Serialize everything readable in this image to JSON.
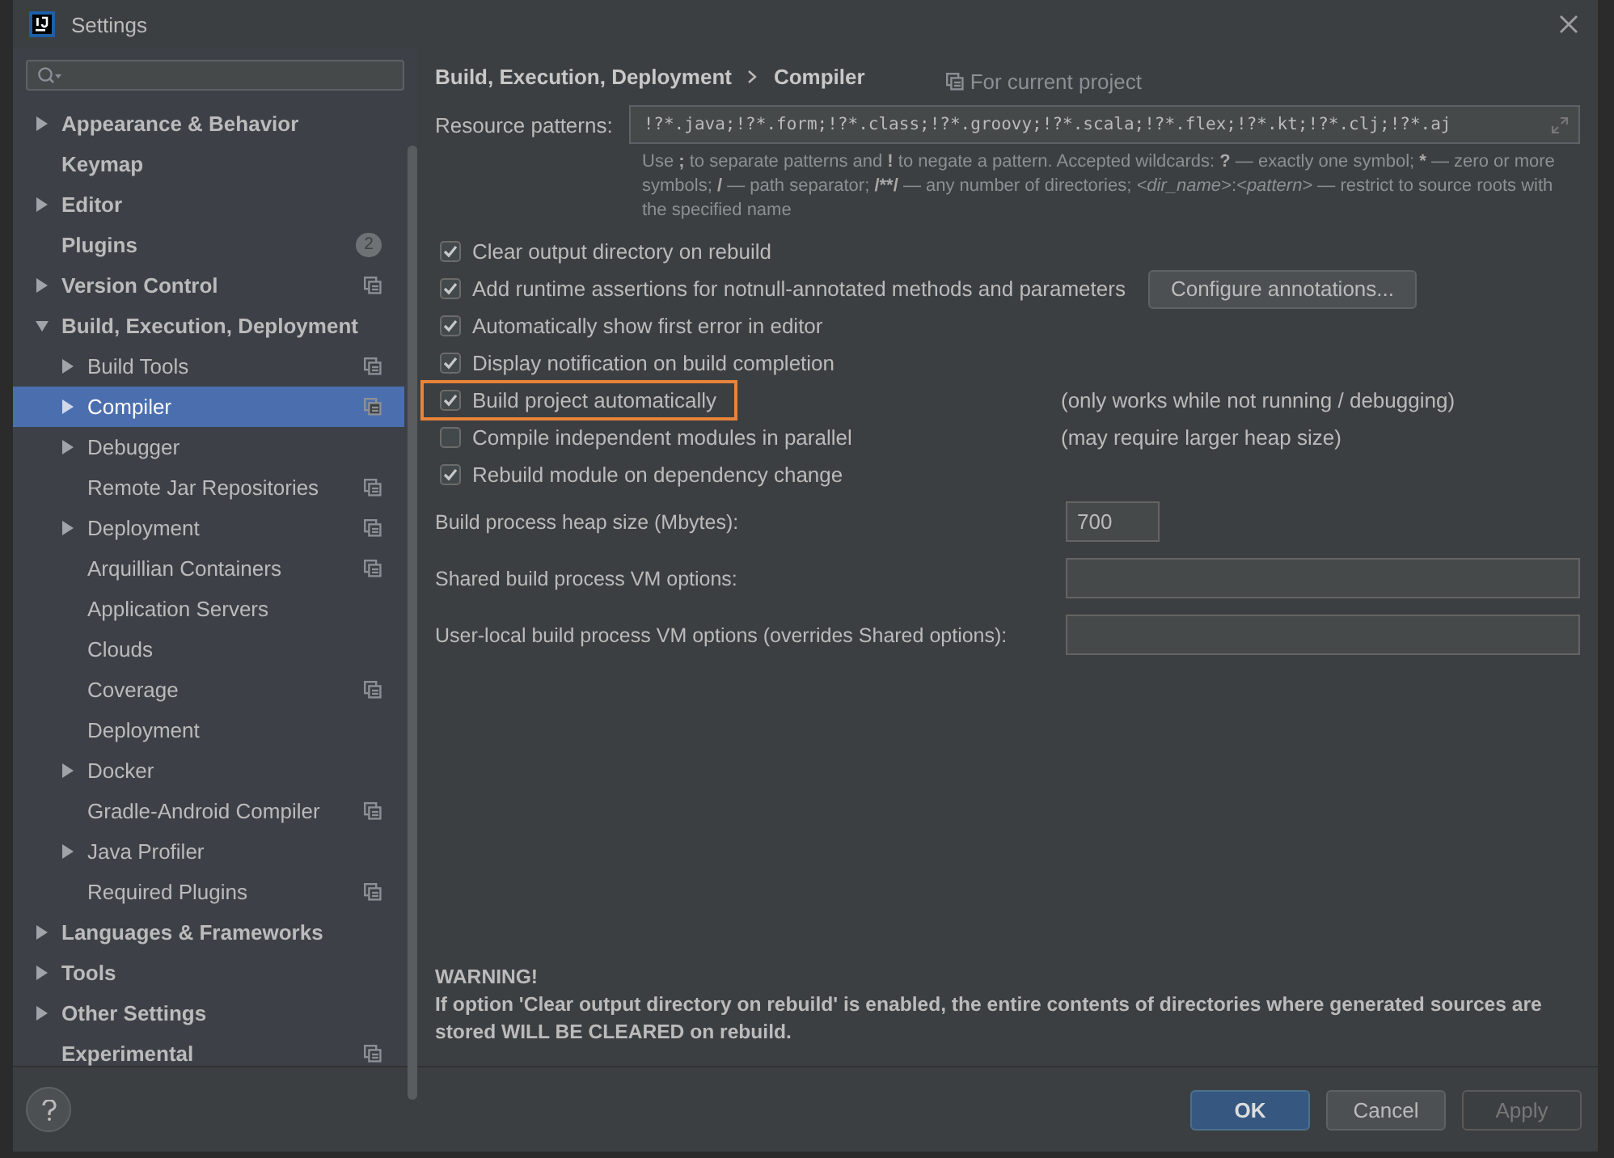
{
  "window": {
    "title": "Settings"
  },
  "sidebar": {
    "items": [
      {
        "label": "Appearance & Behavior",
        "expandable": true,
        "expanded": false,
        "selected": false
      },
      {
        "label": "Keymap",
        "expandable": false,
        "selected": false
      },
      {
        "label": "Editor",
        "expandable": true,
        "expanded": false,
        "selected": false
      },
      {
        "label": "Plugins",
        "expandable": false,
        "selected": false,
        "badge": "2"
      },
      {
        "label": "Version Control",
        "expandable": true,
        "expanded": false,
        "selected": false,
        "project_scope": true
      },
      {
        "label": "Build, Execution, Deployment",
        "expandable": true,
        "expanded": true,
        "selected": false,
        "children": [
          {
            "label": "Build Tools",
            "expandable": true,
            "expanded": false,
            "selected": false,
            "project_scope": true
          },
          {
            "label": "Compiler",
            "expandable": true,
            "expanded": false,
            "selected": true,
            "project_scope": true
          },
          {
            "label": "Debugger",
            "expandable": true,
            "expanded": false,
            "selected": false
          },
          {
            "label": "Remote Jar Repositories",
            "expandable": false,
            "selected": false,
            "project_scope": true
          },
          {
            "label": "Deployment",
            "expandable": true,
            "expanded": false,
            "selected": false,
            "project_scope": true
          },
          {
            "label": "Arquillian Containers",
            "expandable": false,
            "selected": false,
            "project_scope": true
          },
          {
            "label": "Application Servers",
            "expandable": false,
            "selected": false
          },
          {
            "label": "Clouds",
            "expandable": false,
            "selected": false
          },
          {
            "label": "Coverage",
            "expandable": false,
            "selected": false,
            "project_scope": true
          },
          {
            "label": "Deployment",
            "expandable": false,
            "selected": false
          },
          {
            "label": "Docker",
            "expandable": true,
            "expanded": false,
            "selected": false
          },
          {
            "label": "Gradle-Android Compiler",
            "expandable": false,
            "selected": false,
            "project_scope": true
          },
          {
            "label": "Java Profiler",
            "expandable": true,
            "expanded": false,
            "selected": false
          },
          {
            "label": "Required Plugins",
            "expandable": false,
            "selected": false,
            "project_scope": true
          }
        ]
      },
      {
        "label": "Languages & Frameworks",
        "expandable": true,
        "expanded": false,
        "selected": false
      },
      {
        "label": "Tools",
        "expandable": true,
        "expanded": false,
        "selected": false
      },
      {
        "label": "Other Settings",
        "expandable": true,
        "expanded": false,
        "selected": false
      },
      {
        "label": "Experimental",
        "expandable": false,
        "selected": false,
        "project_scope": true
      }
    ]
  },
  "breadcrumb": [
    "Build, Execution, Deployment",
    "Compiler"
  ],
  "scope_label": "For current project",
  "resource_patterns": {
    "label": "Resource patterns:",
    "value": "!?*.java;!?*.form;!?*.class;!?*.groovy;!?*.scala;!?*.flex;!?*.kt;!?*.clj;!?*.aj",
    "hint": [
      {
        "text": "Use "
      },
      {
        "text": ";",
        "kind": "symbol"
      },
      {
        "text": " to separate patterns and "
      },
      {
        "text": "!",
        "kind": "symbol"
      },
      {
        "text": " to negate a pattern. Accepted wildcards: "
      },
      {
        "text": "?",
        "kind": "symbol"
      },
      {
        "text": " — exactly one symbol; "
      },
      {
        "text": "*",
        "kind": "symbol"
      },
      {
        "text": " — zero or more symbols; "
      },
      {
        "text": "/",
        "kind": "symbol"
      },
      {
        "text": " — path separator; "
      },
      {
        "text": "/**/",
        "kind": "symbol"
      },
      {
        "text": " — any number of directories; "
      },
      {
        "text": "<dir_name>",
        "kind": "placeholder"
      },
      {
        "text": ":"
      },
      {
        "text": "<pattern>",
        "kind": "placeholder"
      },
      {
        "text": " — restrict to source roots with the specified name"
      }
    ]
  },
  "options": [
    {
      "label": "Clear output directory on rebuild",
      "checked": true,
      "highlighted": false
    },
    {
      "label": "Add runtime assertions for notnull-annotated methods and parameters",
      "checked": true,
      "highlighted": false,
      "button": "Configure annotations..."
    },
    {
      "label": "Automatically show first error in editor",
      "checked": true,
      "highlighted": false
    },
    {
      "label": "Display notification on build completion",
      "checked": true,
      "highlighted": false
    },
    {
      "label": "Build project automatically",
      "checked": true,
      "highlighted": true,
      "note": "(only works while not running / debugging)"
    },
    {
      "label": "Compile independent modules in parallel",
      "checked": false,
      "highlighted": false,
      "note": "(may require larger heap size)"
    },
    {
      "label": "Rebuild module on dependency change",
      "checked": true,
      "highlighted": false
    }
  ],
  "fields": [
    {
      "label": "Build process heap size (Mbytes):",
      "value": "700",
      "kind": "short"
    },
    {
      "label": "Shared build process VM options:",
      "kind": "wide"
    },
    {
      "label": "User-local build process VM options (overrides Shared options):",
      "kind": "wide"
    }
  ],
  "warning": {
    "title": "WARNING!",
    "text": "If option 'Clear output directory on rebuild' is enabled, the entire contents of directories where generated sources are stored WILL BE CLEARED on rebuild."
  },
  "buttons": [
    {
      "label": "OK",
      "kind": "primary",
      "disabled": false
    },
    {
      "label": "Cancel",
      "kind": "normal",
      "disabled": false
    },
    {
      "label": "Apply",
      "kind": "normal",
      "disabled": true
    }
  ]
}
